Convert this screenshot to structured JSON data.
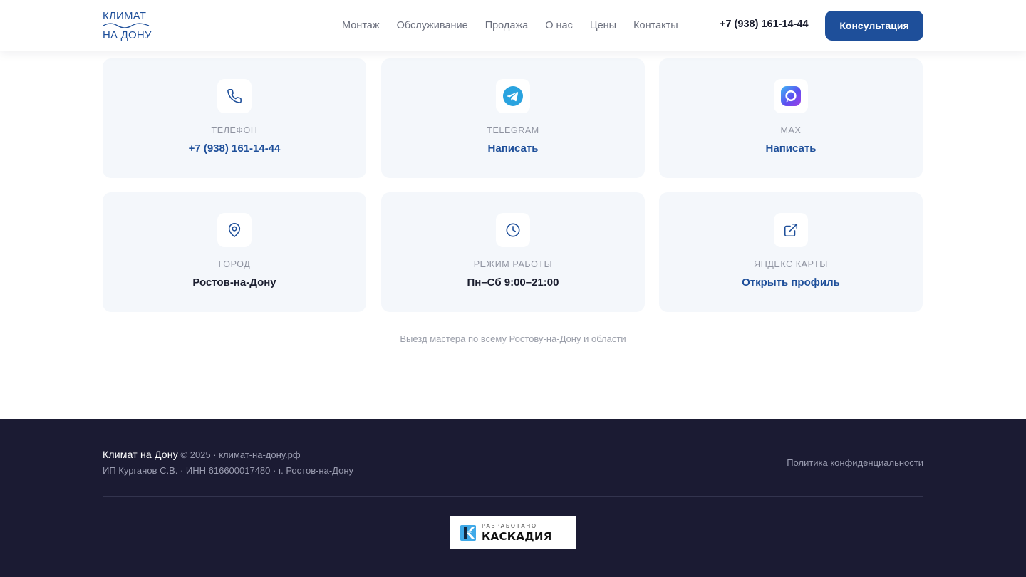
{
  "header": {
    "logo": {
      "line1": "КЛИМАТ",
      "line2": "НА ДОНУ"
    },
    "nav": [
      {
        "label": "Монтаж"
      },
      {
        "label": "Обслуживание"
      },
      {
        "label": "Продажа"
      },
      {
        "label": "О нас"
      },
      {
        "label": "Цены"
      },
      {
        "label": "Контакты"
      }
    ],
    "phone": "+7 (938) 161-14-44",
    "cta_label": "Консультация"
  },
  "contacts": {
    "cards": [
      {
        "label": "ТЕЛЕФОН",
        "value": "+7 (938) 161-14-44",
        "icon": "phone-icon"
      },
      {
        "label": "TELEGRAM",
        "value": "Написать",
        "icon": "telegram-icon"
      },
      {
        "label": "MAX",
        "value": "Написать",
        "icon": "max-messenger-icon"
      },
      {
        "label": "ГОРОД",
        "value": "Ростов-на-Дону",
        "icon": "map-pin-icon"
      },
      {
        "label": "РЕЖИМ РАБОТЫ",
        "value": "Пн–Сб 9:00–21:00",
        "icon": "clock-icon"
      },
      {
        "label": "ЯНДЕКС КАРТЫ",
        "value": "Открыть профиль",
        "icon": "external-link-icon"
      }
    ],
    "note": "Выезд мастера по всему Ростову-на-Дону и области"
  },
  "footer": {
    "brand": "Климат на Дону",
    "copyright": " © 2025 · климат-на-дону.рф",
    "legal": "ИП Курганов С.В. · ИНН 616600017480 · г. Ростов-на-Дону",
    "privacy": "Политика конфиденциальности",
    "badge_small": "РАЗРАБОТАНО",
    "badge_big": "КАСКАДИЯ"
  },
  "colors": {
    "accent": "#1e4f9a",
    "footer_bg": "#1b1b33",
    "card_bg": "#f4f7fb",
    "telegram": "#2aa3df"
  }
}
